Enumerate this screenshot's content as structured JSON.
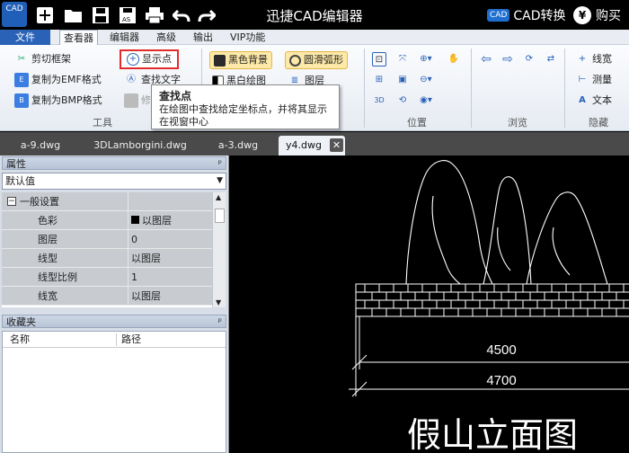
{
  "titlebar": {
    "logo_text": "CAD",
    "title": "迅捷CAD编辑器",
    "cad_convert_badge": "CAD",
    "cad_convert_label": "CAD转换",
    "buy_symbol": "¥",
    "buy_label": "购买"
  },
  "menu": [
    "文件",
    "查看器",
    "编辑器",
    "高级",
    "输出",
    "VIP功能"
  ],
  "ribbon": {
    "tools": {
      "clip_frame": "剪切框架",
      "copy_emf": "复制为EMF格式",
      "copy_bmp": "复制为BMP格式",
      "show_point": "显示点",
      "find_text": "查找文字",
      "trim_partial": "修",
      "label": "工具"
    },
    "view": {
      "black_bg": "黑色背景",
      "smooth_arc": "圆滑弧形",
      "bw_draw": "黑白绘图",
      "layer": "图层"
    },
    "position_label": "位置",
    "browse_label": "浏览",
    "hide": {
      "line_width": "线宽",
      "measure": "测量",
      "text": "文本",
      "label": "隐藏"
    }
  },
  "tooltip": {
    "title": "查找点",
    "body": "在绘图中查找给定坐标点，并将其显示在视窗中心"
  },
  "tabs": [
    "a-9.dwg",
    "3DLamborgini.dwg",
    "a-3.dwg",
    "y4.dwg"
  ],
  "properties": {
    "header": "属性",
    "pin": "ᵖ",
    "select_value": "默认值",
    "section": "一般设置",
    "rows": [
      {
        "key": "色彩",
        "value": "以图层"
      },
      {
        "key": "图层",
        "value": "0"
      },
      {
        "key": "线型",
        "value": "以图层"
      },
      {
        "key": "线型比例",
        "value": "1"
      },
      {
        "key": "线宽",
        "value": "以图层"
      }
    ]
  },
  "favorites": {
    "header": "收藏夹",
    "col_name": "名称",
    "col_path": "路径"
  },
  "drawing": {
    "dim_inner": "4500",
    "dim_outer": "4700",
    "title": "假山立面图"
  }
}
